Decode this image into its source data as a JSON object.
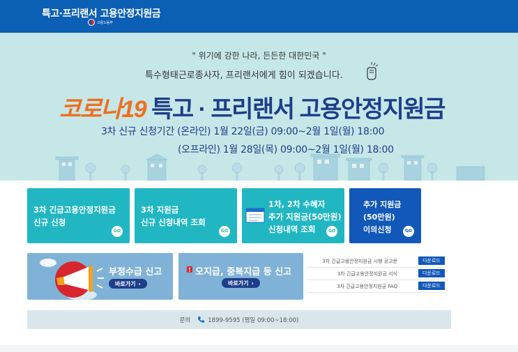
{
  "header": {
    "title": "특고·프리랜서 고용안정지원금",
    "ministry": "고용노동부",
    "search_icon": "search-icon"
  },
  "hero": {
    "slogan_quote": "\" 위기에 강한 나라, 든든한 대한민국 \"",
    "slogan_sub": "특수형태근로종사자, 프리랜서에게 힘이 되겠습니다.",
    "title_highlight": "코로나19",
    "title_rest": "특고 · 프리랜서 고용안정지원금",
    "period_online": "3차 신규 신청기간  (온라인)  1월 22일(금) 09:00~2월 1일(월) 18:00",
    "period_offline": "(오프라인)  1월 28일(목) 09:00~2월 1일(월) 18:00"
  },
  "cards": [
    {
      "line1": "3차 긴급고용안정지원금",
      "line2": "신규 신청",
      "go": "GO"
    },
    {
      "line1": "3차 지원금",
      "line2": "신규 신청내역 조회",
      "go": "GO"
    },
    {
      "line1": "1차, 2차 수혜자",
      "line2": "추가 지원금(50만원)",
      "line3": "신청내역 조회",
      "go": "GO"
    },
    {
      "line1": "추가 지원금",
      "line2": "(50만원)",
      "line3": "이의신청",
      "go": "GO"
    }
  ],
  "banners": {
    "fraud": {
      "title": "부정수급 신고",
      "button": "바로가기"
    },
    "overpay": {
      "title": "오지급, 중복지급 등 신고",
      "button": "바로가기"
    }
  },
  "downloads": [
    {
      "name": "3차 긴급고용안정지원금 시행 공고문",
      "button": "다운로드"
    },
    {
      "name": "3차 긴급고용안정지원금 서식",
      "button": "다운로드"
    },
    {
      "name": "3차 긴급고용안정지원금 FAQ",
      "button": "다운로드"
    }
  ],
  "contact": {
    "label": "문의",
    "phone": "1899-9595 (평일 09:00~18:00)"
  },
  "colors": {
    "header": "#0b5fb5",
    "hero_bg": "#c6e7e7",
    "teal": "#21b7c2",
    "blue": "#1158b9",
    "navy": "#1d3e8a",
    "orange": "#ef6f20"
  }
}
